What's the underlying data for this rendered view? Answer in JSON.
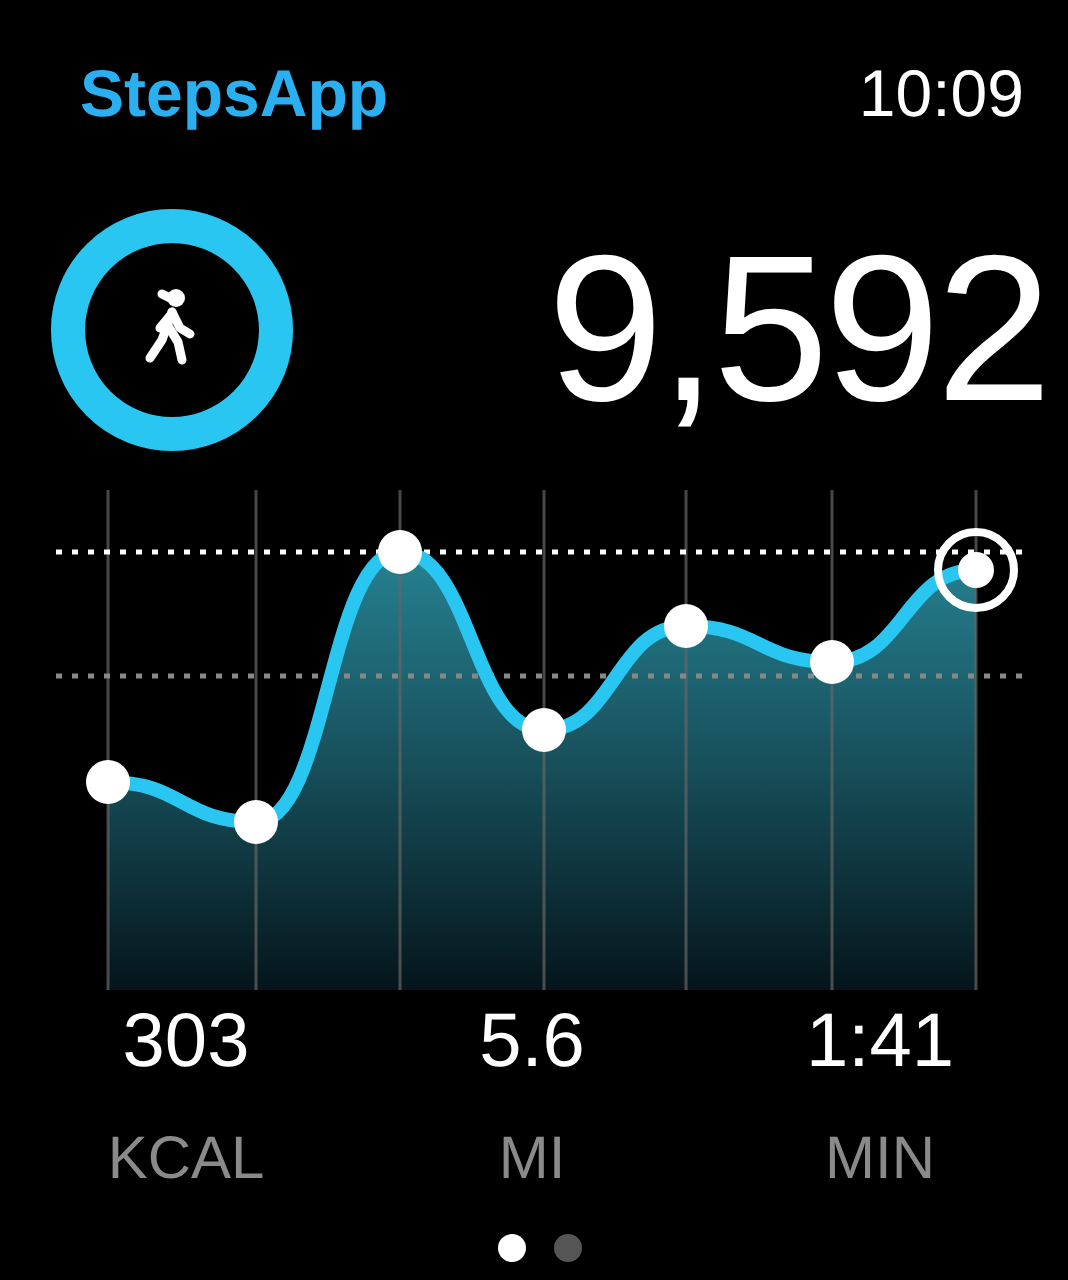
{
  "header": {
    "app_name": "StepsApp",
    "time": "10:09"
  },
  "goal_ring": {
    "level": 1
  },
  "steps": "9,592",
  "stats": [
    {
      "value": "303",
      "unit": "KCAL"
    },
    {
      "value": "5.6",
      "unit": "MI"
    },
    {
      "value": "1:41",
      "unit": "MIN"
    }
  ],
  "page_dots": [
    {
      "selected": true
    },
    {
      "selected": false
    }
  ]
}
